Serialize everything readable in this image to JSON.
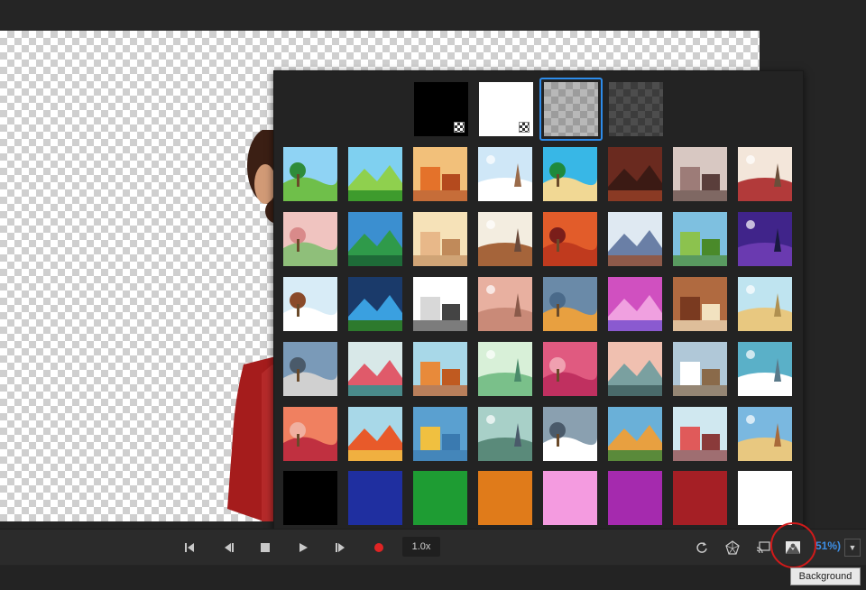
{
  "colors": {
    "accent": "#2d8ceb",
    "highlight_circle": "#d01a1a"
  },
  "background_picker": {
    "top_row": [
      {
        "name": "solid-black-checker",
        "kind": "black"
      },
      {
        "name": "solid-white-checker",
        "kind": "white"
      },
      {
        "name": "transparent-light",
        "kind": "checker-light",
        "selected": true
      },
      {
        "name": "transparent-dark",
        "kind": "checker-dark"
      }
    ],
    "scenes": [
      "forest-path",
      "meadow-trees",
      "autumn-park",
      "winter-park",
      "tropical-island",
      "rocky-cave",
      "old-house",
      "brick-cafe",
      "bamboo-garden",
      "pine-valley",
      "room-interior",
      "living-room",
      "red-canyon",
      "office-desk",
      "green-hills",
      "night-city",
      "snow-cabin",
      "stadium-lights",
      "photo-studio",
      "arch-room",
      "city-autumn",
      "pink-dreamscape",
      "wooden-wall",
      "desert-cactus",
      "harbor-boat",
      "cherry-tree",
      "mesa-desert",
      "green-hills-mist",
      "pink-clouds",
      "coastal-tree",
      "lighthouse",
      "snow-mountains",
      "red-hills",
      "playground",
      "river-town",
      "road-valley",
      "old-ship",
      "treehouse",
      "coral-reef",
      "farmhouse"
    ],
    "solid_colors": [
      "#000000",
      "#1f2fa0",
      "#1e9c33",
      "#e07b1a",
      "#f49be0",
      "#a52aae",
      "#a51f25",
      "#ffffff"
    ]
  },
  "toolbar": {
    "speed": "1.0x",
    "zoom": "51%)",
    "buttons": [
      "skip-start",
      "step-back",
      "stop",
      "play",
      "step-forward",
      "record",
      "refresh",
      "wireframe",
      "cast",
      "background"
    ]
  },
  "tooltip": {
    "text": "Background"
  }
}
